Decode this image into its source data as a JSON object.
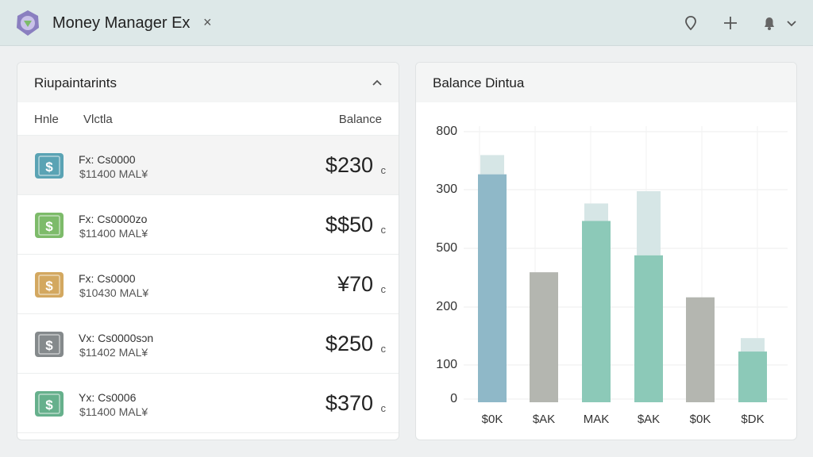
{
  "window": {
    "title": "Money Manager Ex",
    "close_glyph": "×",
    "toolbar_icons": [
      "location-icon",
      "plus-icon",
      "bell-icon",
      "chevron-down-icon"
    ]
  },
  "left_panel": {
    "title": "Riupaintarints",
    "col_headers": {
      "c1": "Hnle",
      "c2": "Vlctla",
      "c3": "Balance"
    },
    "accounts": [
      {
        "name": "Fx: Cs0000",
        "sub": "$11400 MAL¥",
        "balance": "$230",
        "suffix": "c",
        "icon_color": "#5aa3b4",
        "selected": true
      },
      {
        "name": "Fx: Cs0000zo",
        "sub": "$11400 MAL¥",
        "balance": "$$50",
        "suffix": "c",
        "icon_color": "#7dbb6a",
        "selected": false
      },
      {
        "name": "Fx: Cs0000",
        "sub": "$10430 MAL¥",
        "balance": "¥70",
        "suffix": "c",
        "icon_color": "#d3a860",
        "selected": false
      },
      {
        "name": "Vx: Cs0000sɔn",
        "sub": "$11402 MAL¥",
        "balance": "$250",
        "suffix": "c",
        "icon_color": "#858a8c",
        "selected": false
      },
      {
        "name": "Yx: Cs0006",
        "sub": "$11400 MAL¥",
        "balance": "$370",
        "suffix": "c",
        "icon_color": "#66b08c",
        "selected": false
      }
    ]
  },
  "right_panel": {
    "title": "Balance Dintua"
  },
  "chart_data": {
    "type": "bar",
    "title": "Balance Dintua",
    "y_tick_labels": [
      "0",
      "100",
      "200",
      "500",
      "300",
      "800"
    ],
    "categories": [
      "$0K",
      "$AK",
      "MAK",
      "$AK",
      "$0K",
      "$DK"
    ],
    "values": [
      391,
      223,
      311,
      252,
      180,
      87
    ],
    "cap_values": [
      424,
      0,
      341,
      362,
      0,
      110
    ],
    "colors": [
      "#8fb8c8",
      "#b4b6b0",
      "#8cc9b8",
      "#8cc9b8",
      "#b4b6b0",
      "#8cc9b8"
    ],
    "cap_color": "#d6e6e6",
    "grid": true
  }
}
